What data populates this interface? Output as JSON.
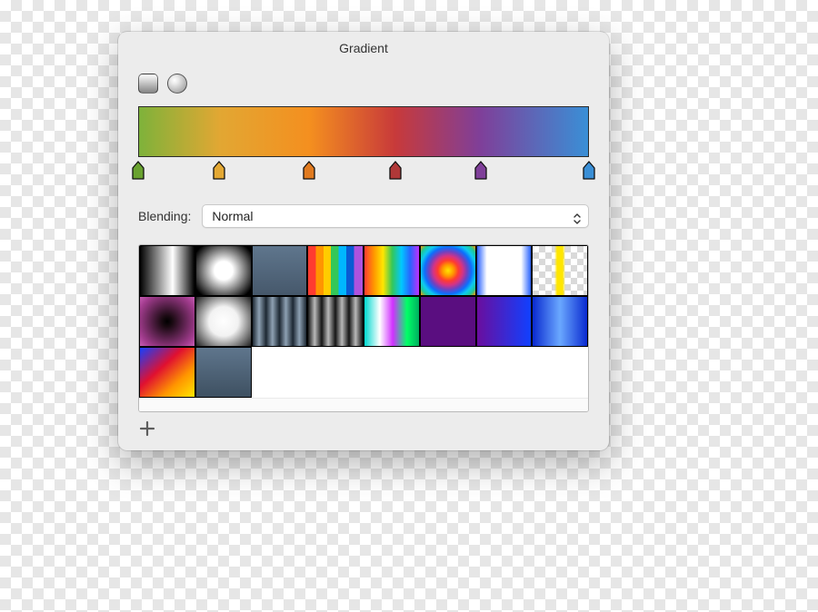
{
  "title": "Gradient",
  "gradient_type": "linear",
  "gradient_bar_css": "linear-gradient(to right,#7eb23a 0%,#e2a733 18%,#f48f1f 38%,#c83a3a 57%,#7f3f99 76%,#3a8fd6 100%)",
  "stops": [
    {
      "pos": 0,
      "color": "#69a22f"
    },
    {
      "pos": 18,
      "color": "#e3a833"
    },
    {
      "pos": 38,
      "color": "#e07a1f"
    },
    {
      "pos": 57,
      "color": "#b03838"
    },
    {
      "pos": 76,
      "color": "#7f3f99"
    },
    {
      "pos": 100,
      "color": "#3a8fd6"
    }
  ],
  "blending": {
    "label": "Blending:",
    "value": "Normal"
  },
  "presets": [
    {
      "name": "black-white-linear",
      "css": "linear-gradient(to right,#000 0%,#fff 60%,#000 100%)"
    },
    {
      "name": "white-radial",
      "css": "radial-gradient(circle,#ffffff 0%,#ffffff 25%,#000 90%)"
    },
    {
      "name": "steel-flat",
      "css": "linear-gradient(to bottom,#5f768d,#46586b)"
    },
    {
      "name": "rainbow-stripe",
      "css": "linear-gradient(to right,#ff3b30 0 14%,#ff9500 14% 28%,#ffcc00 28% 42%,#34c759 42% 56%,#00b7ff 56% 70%,#0a5bd3 70% 84%,#af52de 84% 100%)"
    },
    {
      "name": "rainbow-smooth",
      "css": "linear-gradient(to right,#ff3b30 0%,#ff9500 17%,#ffe600 34%,#34c759 51%,#00c8ff 68%,#2a62ff 84%,#c030ff 100%)"
    },
    {
      "name": "rainbow-radial",
      "css": "radial-gradient(circle,#ffe600 0%,#ff9500 16%,#ff3b30 28%,#d63384 40%,#6f42c1 52%,#0d6efd 64%,#0dcaf0 76%,#20c997 88%,#ff9500 100%)"
    },
    {
      "name": "blue-edge",
      "css": "linear-gradient(to right,#2a62ff 0%,#ffffff 18%,#ffffff 82%,#2a62ff 100%)",
      "checker": true
    },
    {
      "name": "yellow-stripe",
      "css": "linear-gradient(to right,transparent 0%,transparent 40%,#ffe600 45%,#ffe600 55%,transparent 60%,transparent 100%)",
      "checker": true
    },
    {
      "name": "magenta-black-radial",
      "css": "radial-gradient(circle,#000 0%,#1a0a12 15%,#a23c8e 80%,#c65db3 100%)"
    },
    {
      "name": "white-radial-dark",
      "css": "radial-gradient(circle,#ffffff 0%,#f2f2f2 40%,#202020 100%)"
    },
    {
      "name": "steel-ribs-1",
      "css": "linear-gradient(to right,#1d2833 0%,#8ea1b3 12%,#1d2833 25%,#8ea1b3 37%,#1d2833 50%,#8ea1b3 62%,#1d2833 75%,#8ea1b3 87%,#1d2833 100%)"
    },
    {
      "name": "grey-ribs",
      "css": "linear-gradient(to right,#161616 0%,#b9b9b9 12%,#161616 25%,#b9b9b9 37%,#161616 50%,#b9b9b9 62%,#161616 75%,#b9b9b9 87%,#161616 100%)"
    },
    {
      "name": "cyan-magenta-green",
      "css": "linear-gradient(to right,#00d8d0 0%,#ffffff 28%,#d030ff 52%,#00ff66 78%,#00b060 100%)"
    },
    {
      "name": "purple-flat",
      "css": "linear-gradient(to right,#5a0e80,#5a0e80)"
    },
    {
      "name": "purple-blue",
      "css": "linear-gradient(to right,#6a0e9e 0%,#1140ff 100%)"
    },
    {
      "name": "blue-glow",
      "css": "linear-gradient(to right,#0a2ad0 0%,#6aa8ff 50%,#0a2ad0 100%)"
    },
    {
      "name": "blue-red-gold",
      "css": "linear-gradient(to bottom right,#1440ff 0%,#e01030 40%,#ff9500 70%,#ffe600 100%)"
    },
    {
      "name": "steel-flat-2",
      "css": "linear-gradient(to bottom,#5f768d,#3e5061)"
    }
  ],
  "add_label": "Add gradient"
}
